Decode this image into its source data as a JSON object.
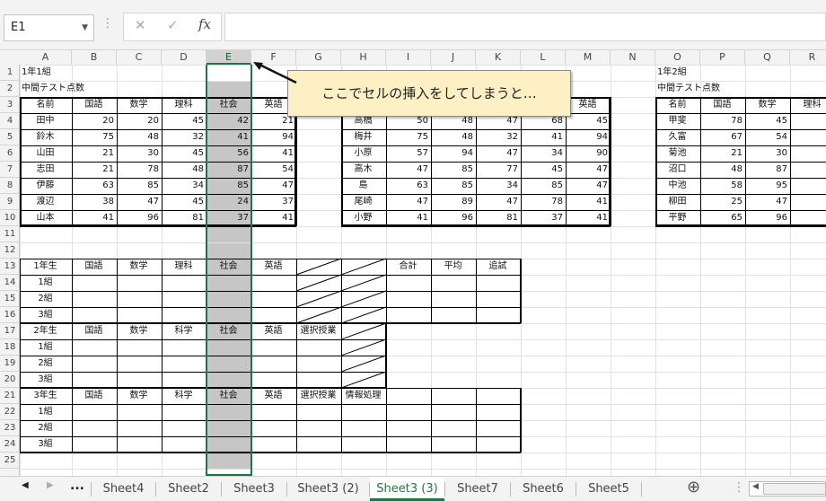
{
  "name_box": {
    "value": "E1",
    "dropdown_icon": "triangle-down"
  },
  "formula_bar": {
    "menu_icon": "vertical-dots",
    "cancel_icon": "✕",
    "enter_icon": "✓",
    "fx_label": "fx",
    "value": ""
  },
  "columns": [
    "A",
    "B",
    "C",
    "D",
    "E",
    "F",
    "G",
    "H",
    "I",
    "J",
    "K",
    "L",
    "M",
    "N",
    "O",
    "P",
    "Q",
    "R"
  ],
  "rows": [
    "1",
    "2",
    "3",
    "4",
    "5",
    "6",
    "7",
    "8",
    "9",
    "10",
    "11",
    "12",
    "13",
    "14",
    "15",
    "16",
    "17",
    "18",
    "19",
    "20",
    "21",
    "22",
    "23",
    "24",
    "25"
  ],
  "selected_column": "E",
  "cells": [
    {
      "c": "A",
      "r": 1,
      "v": "1年1組",
      "a": "l"
    },
    {
      "c": "A",
      "r": 2,
      "v": "中間テスト点数",
      "a": "l"
    },
    {
      "c": "A",
      "r": 3,
      "v": "名前",
      "a": "c"
    },
    {
      "c": "B",
      "r": 3,
      "v": "国語",
      "a": "c"
    },
    {
      "c": "C",
      "r": 3,
      "v": "数学",
      "a": "c"
    },
    {
      "c": "D",
      "r": 3,
      "v": "理科",
      "a": "c"
    },
    {
      "c": "E",
      "r": 3,
      "v": "社会",
      "a": "c"
    },
    {
      "c": "F",
      "r": 3,
      "v": "英語",
      "a": "c"
    },
    {
      "c": "A",
      "r": 4,
      "v": "田中",
      "a": "c"
    },
    {
      "c": "B",
      "r": 4,
      "v": "20",
      "a": "r"
    },
    {
      "c": "C",
      "r": 4,
      "v": "20",
      "a": "r"
    },
    {
      "c": "D",
      "r": 4,
      "v": "45",
      "a": "r"
    },
    {
      "c": "E",
      "r": 4,
      "v": "42",
      "a": "r"
    },
    {
      "c": "F",
      "r": 4,
      "v": "21",
      "a": "r"
    },
    {
      "c": "A",
      "r": 5,
      "v": "鈴木",
      "a": "c"
    },
    {
      "c": "B",
      "r": 5,
      "v": "75",
      "a": "r"
    },
    {
      "c": "C",
      "r": 5,
      "v": "48",
      "a": "r"
    },
    {
      "c": "D",
      "r": 5,
      "v": "32",
      "a": "r"
    },
    {
      "c": "E",
      "r": 5,
      "v": "41",
      "a": "r"
    },
    {
      "c": "F",
      "r": 5,
      "v": "94",
      "a": "r"
    },
    {
      "c": "A",
      "r": 6,
      "v": "山田",
      "a": "c"
    },
    {
      "c": "B",
      "r": 6,
      "v": "21",
      "a": "r"
    },
    {
      "c": "C",
      "r": 6,
      "v": "30",
      "a": "r"
    },
    {
      "c": "D",
      "r": 6,
      "v": "45",
      "a": "r"
    },
    {
      "c": "E",
      "r": 6,
      "v": "56",
      "a": "r"
    },
    {
      "c": "F",
      "r": 6,
      "v": "41",
      "a": "r"
    },
    {
      "c": "A",
      "r": 7,
      "v": "志田",
      "a": "c"
    },
    {
      "c": "B",
      "r": 7,
      "v": "21",
      "a": "r"
    },
    {
      "c": "C",
      "r": 7,
      "v": "78",
      "a": "r"
    },
    {
      "c": "D",
      "r": 7,
      "v": "48",
      "a": "r"
    },
    {
      "c": "E",
      "r": 7,
      "v": "87",
      "a": "r"
    },
    {
      "c": "F",
      "r": 7,
      "v": "54",
      "a": "r"
    },
    {
      "c": "A",
      "r": 8,
      "v": "伊藤",
      "a": "c"
    },
    {
      "c": "B",
      "r": 8,
      "v": "63",
      "a": "r"
    },
    {
      "c": "C",
      "r": 8,
      "v": "85",
      "a": "r"
    },
    {
      "c": "D",
      "r": 8,
      "v": "34",
      "a": "r"
    },
    {
      "c": "E",
      "r": 8,
      "v": "85",
      "a": "r"
    },
    {
      "c": "F",
      "r": 8,
      "v": "47",
      "a": "r"
    },
    {
      "c": "A",
      "r": 9,
      "v": "渡辺",
      "a": "c"
    },
    {
      "c": "B",
      "r": 9,
      "v": "38",
      "a": "r"
    },
    {
      "c": "C",
      "r": 9,
      "v": "47",
      "a": "r"
    },
    {
      "c": "D",
      "r": 9,
      "v": "45",
      "a": "r"
    },
    {
      "c": "E",
      "r": 9,
      "v": "24",
      "a": "r"
    },
    {
      "c": "F",
      "r": 9,
      "v": "37",
      "a": "r"
    },
    {
      "c": "A",
      "r": 10,
      "v": "山本",
      "a": "c"
    },
    {
      "c": "B",
      "r": 10,
      "v": "41",
      "a": "r"
    },
    {
      "c": "C",
      "r": 10,
      "v": "96",
      "a": "r"
    },
    {
      "c": "D",
      "r": 10,
      "v": "81",
      "a": "r"
    },
    {
      "c": "E",
      "r": 10,
      "v": "37",
      "a": "r"
    },
    {
      "c": "F",
      "r": 10,
      "v": "41",
      "a": "r"
    },
    {
      "c": "M",
      "r": 3,
      "v": "英語",
      "a": "c"
    },
    {
      "c": "H",
      "r": 4,
      "v": "高橋",
      "a": "c"
    },
    {
      "c": "I",
      "r": 4,
      "v": "50",
      "a": "r"
    },
    {
      "c": "J",
      "r": 4,
      "v": "48",
      "a": "r"
    },
    {
      "c": "K",
      "r": 4,
      "v": "47",
      "a": "r"
    },
    {
      "c": "L",
      "r": 4,
      "v": "68",
      "a": "r"
    },
    {
      "c": "M",
      "r": 4,
      "v": "45",
      "a": "r"
    },
    {
      "c": "H",
      "r": 5,
      "v": "梅井",
      "a": "c"
    },
    {
      "c": "I",
      "r": 5,
      "v": "75",
      "a": "r"
    },
    {
      "c": "J",
      "r": 5,
      "v": "48",
      "a": "r"
    },
    {
      "c": "K",
      "r": 5,
      "v": "32",
      "a": "r"
    },
    {
      "c": "L",
      "r": 5,
      "v": "41",
      "a": "r"
    },
    {
      "c": "M",
      "r": 5,
      "v": "94",
      "a": "r"
    },
    {
      "c": "H",
      "r": 6,
      "v": "小原",
      "a": "c"
    },
    {
      "c": "I",
      "r": 6,
      "v": "57",
      "a": "r"
    },
    {
      "c": "J",
      "r": 6,
      "v": "94",
      "a": "r"
    },
    {
      "c": "K",
      "r": 6,
      "v": "47",
      "a": "r"
    },
    {
      "c": "L",
      "r": 6,
      "v": "34",
      "a": "r"
    },
    {
      "c": "M",
      "r": 6,
      "v": "90",
      "a": "r"
    },
    {
      "c": "H",
      "r": 7,
      "v": "高木",
      "a": "c"
    },
    {
      "c": "I",
      "r": 7,
      "v": "47",
      "a": "r"
    },
    {
      "c": "J",
      "r": 7,
      "v": "85",
      "a": "r"
    },
    {
      "c": "K",
      "r": 7,
      "v": "77",
      "a": "r"
    },
    {
      "c": "L",
      "r": 7,
      "v": "45",
      "a": "r"
    },
    {
      "c": "M",
      "r": 7,
      "v": "47",
      "a": "r"
    },
    {
      "c": "H",
      "r": 8,
      "v": "島",
      "a": "c"
    },
    {
      "c": "I",
      "r": 8,
      "v": "63",
      "a": "r"
    },
    {
      "c": "J",
      "r": 8,
      "v": "85",
      "a": "r"
    },
    {
      "c": "K",
      "r": 8,
      "v": "34",
      "a": "r"
    },
    {
      "c": "L",
      "r": 8,
      "v": "85",
      "a": "r"
    },
    {
      "c": "M",
      "r": 8,
      "v": "47",
      "a": "r"
    },
    {
      "c": "H",
      "r": 9,
      "v": "尾崎",
      "a": "c"
    },
    {
      "c": "I",
      "r": 9,
      "v": "47",
      "a": "r"
    },
    {
      "c": "J",
      "r": 9,
      "v": "89",
      "a": "r"
    },
    {
      "c": "K",
      "r": 9,
      "v": "47",
      "a": "r"
    },
    {
      "c": "L",
      "r": 9,
      "v": "78",
      "a": "r"
    },
    {
      "c": "M",
      "r": 9,
      "v": "41",
      "a": "r"
    },
    {
      "c": "H",
      "r": 10,
      "v": "小野",
      "a": "c"
    },
    {
      "c": "I",
      "r": 10,
      "v": "41",
      "a": "r"
    },
    {
      "c": "J",
      "r": 10,
      "v": "96",
      "a": "r"
    },
    {
      "c": "K",
      "r": 10,
      "v": "81",
      "a": "r"
    },
    {
      "c": "L",
      "r": 10,
      "v": "37",
      "a": "r"
    },
    {
      "c": "M",
      "r": 10,
      "v": "41",
      "a": "r"
    },
    {
      "c": "O",
      "r": 1,
      "v": "1年2組",
      "a": "l"
    },
    {
      "c": "O",
      "r": 2,
      "v": "中間テスト点数",
      "a": "l"
    },
    {
      "c": "O",
      "r": 3,
      "v": "名前",
      "a": "c"
    },
    {
      "c": "P",
      "r": 3,
      "v": "国語",
      "a": "c"
    },
    {
      "c": "Q",
      "r": 3,
      "v": "数学",
      "a": "c"
    },
    {
      "c": "R",
      "r": 3,
      "v": "理科",
      "a": "c"
    },
    {
      "c": "O",
      "r": 4,
      "v": "甲斐",
      "a": "c"
    },
    {
      "c": "P",
      "r": 4,
      "v": "78",
      "a": "r"
    },
    {
      "c": "Q",
      "r": 4,
      "v": "45",
      "a": "r"
    },
    {
      "c": "R",
      "r": 4,
      "v": "8",
      "a": "r"
    },
    {
      "c": "O",
      "r": 5,
      "v": "久富",
      "a": "c"
    },
    {
      "c": "P",
      "r": 5,
      "v": "67",
      "a": "r"
    },
    {
      "c": "Q",
      "r": 5,
      "v": "54",
      "a": "r"
    },
    {
      "c": "R",
      "r": 5,
      "v": "4",
      "a": "r"
    },
    {
      "c": "O",
      "r": 6,
      "v": "菊池",
      "a": "c"
    },
    {
      "c": "P",
      "r": 6,
      "v": "21",
      "a": "r"
    },
    {
      "c": "Q",
      "r": 6,
      "v": "30",
      "a": "r"
    },
    {
      "c": "R",
      "r": 6,
      "v": "4",
      "a": "r"
    },
    {
      "c": "O",
      "r": 7,
      "v": "沼口",
      "a": "c"
    },
    {
      "c": "P",
      "r": 7,
      "v": "48",
      "a": "r"
    },
    {
      "c": "Q",
      "r": 7,
      "v": "87",
      "a": "r"
    },
    {
      "c": "R",
      "r": 7,
      "v": "2",
      "a": "r"
    },
    {
      "c": "O",
      "r": 8,
      "v": "中池",
      "a": "c"
    },
    {
      "c": "P",
      "r": 8,
      "v": "58",
      "a": "r"
    },
    {
      "c": "Q",
      "r": 8,
      "v": "95",
      "a": "r"
    },
    {
      "c": "R",
      "r": 8,
      "v": "7",
      "a": "r"
    },
    {
      "c": "O",
      "r": 9,
      "v": "柳田",
      "a": "c"
    },
    {
      "c": "P",
      "r": 9,
      "v": "25",
      "a": "r"
    },
    {
      "c": "Q",
      "r": 9,
      "v": "47",
      "a": "r"
    },
    {
      "c": "R",
      "r": 9,
      "v": "4",
      "a": "r"
    },
    {
      "c": "O",
      "r": 10,
      "v": "平野",
      "a": "c"
    },
    {
      "c": "P",
      "r": 10,
      "v": "65",
      "a": "r"
    },
    {
      "c": "Q",
      "r": 10,
      "v": "96",
      "a": "r"
    },
    {
      "c": "R",
      "r": 10,
      "v": "8",
      "a": "r"
    },
    {
      "c": "A",
      "r": 13,
      "v": "1年生",
      "a": "c"
    },
    {
      "c": "B",
      "r": 13,
      "v": "国語",
      "a": "c"
    },
    {
      "c": "C",
      "r": 13,
      "v": "数学",
      "a": "c"
    },
    {
      "c": "D",
      "r": 13,
      "v": "理科",
      "a": "c"
    },
    {
      "c": "E",
      "r": 13,
      "v": "社会",
      "a": "c"
    },
    {
      "c": "F",
      "r": 13,
      "v": "英語",
      "a": "c"
    },
    {
      "c": "I",
      "r": 13,
      "v": "合計",
      "a": "c"
    },
    {
      "c": "J",
      "r": 13,
      "v": "平均",
      "a": "c"
    },
    {
      "c": "K",
      "r": 13,
      "v": "追試",
      "a": "c"
    },
    {
      "c": "A",
      "r": 14,
      "v": "1組",
      "a": "c"
    },
    {
      "c": "A",
      "r": 15,
      "v": "2組",
      "a": "c"
    },
    {
      "c": "A",
      "r": 16,
      "v": "3組",
      "a": "c"
    },
    {
      "c": "A",
      "r": 17,
      "v": "2年生",
      "a": "c"
    },
    {
      "c": "B",
      "r": 17,
      "v": "国語",
      "a": "c"
    },
    {
      "c": "C",
      "r": 17,
      "v": "数学",
      "a": "c"
    },
    {
      "c": "D",
      "r": 17,
      "v": "科学",
      "a": "c"
    },
    {
      "c": "E",
      "r": 17,
      "v": "社会",
      "a": "c"
    },
    {
      "c": "F",
      "r": 17,
      "v": "英語",
      "a": "c"
    },
    {
      "c": "G",
      "r": 17,
      "v": "選択授業",
      "a": "c"
    },
    {
      "c": "A",
      "r": 18,
      "v": "1組",
      "a": "c"
    },
    {
      "c": "A",
      "r": 19,
      "v": "2組",
      "a": "c"
    },
    {
      "c": "A",
      "r": 20,
      "v": "3組",
      "a": "c"
    },
    {
      "c": "A",
      "r": 21,
      "v": "3年生",
      "a": "c"
    },
    {
      "c": "B",
      "r": 21,
      "v": "国語",
      "a": "c"
    },
    {
      "c": "C",
      "r": 21,
      "v": "数学",
      "a": "c"
    },
    {
      "c": "D",
      "r": 21,
      "v": "科学",
      "a": "c"
    },
    {
      "c": "E",
      "r": 21,
      "v": "社会",
      "a": "c"
    },
    {
      "c": "F",
      "r": 21,
      "v": "英語",
      "a": "c"
    },
    {
      "c": "G",
      "r": 21,
      "v": "選択授業",
      "a": "c"
    },
    {
      "c": "H",
      "r": 21,
      "v": "情報処理",
      "a": "c"
    },
    {
      "c": "A",
      "r": 22,
      "v": "1組",
      "a": "c"
    },
    {
      "c": "A",
      "r": 23,
      "v": "2組",
      "a": "c"
    },
    {
      "c": "A",
      "r": 24,
      "v": "3組",
      "a": "c"
    }
  ],
  "callout": {
    "text": "ここでセルの挿入をしてしまうと…"
  },
  "sheet_tabs": [
    "Sheet4",
    "Sheet2",
    "Sheet3",
    "Sheet3 (2)",
    "Sheet3 (3)",
    "Sheet7",
    "Sheet6",
    "Sheet5"
  ],
  "active_sheet": "Sheet3 (3)",
  "tab_nav": {
    "prev_icon": "◀",
    "next_icon": "▶",
    "more_label": "...",
    "add_icon": "⊕",
    "options_icon": "⋮",
    "scroll_left_icon": "◀"
  },
  "colors": {
    "accent": "#217346",
    "selected_fill": "#c6c6c6",
    "callout_fill": "#fdf0c4",
    "gridline": "#e1e1e1",
    "header_bg": "#f3f3f3"
  }
}
